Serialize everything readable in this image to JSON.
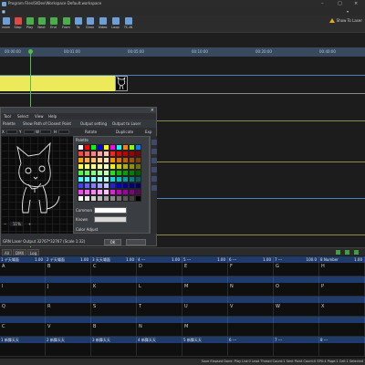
{
  "window": {
    "title": "Program Files\\StDev\\Workspace Default.workspace"
  },
  "toolbar": {
    "buttons": [
      {
        "label": "ream",
        "icon": "stream-icon"
      },
      {
        "label": "Stop",
        "icon": "stop-icon"
      },
      {
        "label": "Play",
        "icon": "play-icon"
      },
      {
        "label": "Next",
        "icon": "next-icon"
      },
      {
        "label": "End",
        "icon": "end-icon"
      },
      {
        "label": "From",
        "icon": "from-icon"
      },
      {
        "label": "To",
        "icon": "to-icon"
      },
      {
        "label": "Clear",
        "icon": "clear-icon"
      },
      {
        "label": "Video",
        "icon": "video-icon"
      },
      {
        "label": "Loop",
        "icon": "loop-icon"
      },
      {
        "label": "TC-IN",
        "icon": "tc-in-icon"
      }
    ],
    "right_label": "Show To Laser"
  },
  "ruler": {
    "ticks": [
      "00:00:00",
      "00:01:00",
      "00:05:00",
      "00:10:00",
      "00:20:00",
      "00:40:00"
    ]
  },
  "dialog": {
    "menu": [
      "Tool",
      "Select",
      "View",
      "Help"
    ],
    "tools": [
      "Palette",
      "Show Path of Closest Point",
      "Output setting",
      "Output to Laser"
    ],
    "fields": [
      "X",
      "Y",
      "W",
      "H",
      "Rotate",
      "Duplicate",
      "Exp"
    ],
    "zoom": "11%",
    "status": "GRN Laser Output 32767*32767 (Scale 1:32)",
    "ok_label": "OK"
  },
  "palette": {
    "header": "Palette",
    "common_label": "Common",
    "known_label": "Known",
    "color_adjust_label": "Color Adjust",
    "colors": [
      "#ffffff",
      "#ff0000",
      "#00ff00",
      "#0000ff",
      "#ffff00",
      "#ff00ff",
      "#00ffff",
      "#ff8000",
      "#80ff00",
      "#0080ff",
      "#ff4040",
      "#ff6060",
      "#ff8080",
      "#ffa0a0",
      "#ffc0c0",
      "#ff2020",
      "#e00000",
      "#c00000",
      "#a00000",
      "#800000",
      "#ffa500",
      "#ffb030",
      "#ffc060",
      "#ffd090",
      "#ffe0b0",
      "#ff9000",
      "#e07000",
      "#c06000",
      "#a05000",
      "#804000",
      "#ffff40",
      "#ffff60",
      "#ffff80",
      "#ffffa0",
      "#ffffc0",
      "#f0f000",
      "#d0d000",
      "#b0b000",
      "#909000",
      "#707000",
      "#40ff40",
      "#60ff60",
      "#80ff80",
      "#a0ffa0",
      "#c0ffc0",
      "#20e020",
      "#00c000",
      "#00a000",
      "#008000",
      "#006000",
      "#40ffff",
      "#60ffff",
      "#80ffff",
      "#a0ffff",
      "#c0ffff",
      "#00e0e0",
      "#00c0c0",
      "#00a0a0",
      "#008080",
      "#006060",
      "#4040ff",
      "#6060ff",
      "#8080ff",
      "#a0a0ff",
      "#c0c0ff",
      "#2020e0",
      "#0000c0",
      "#0000a0",
      "#000080",
      "#000060",
      "#ff40ff",
      "#ff60ff",
      "#ff80ff",
      "#ffa0ff",
      "#ffc0ff",
      "#e020e0",
      "#c000c0",
      "#a000a0",
      "#800080",
      "#600060",
      "#ffffff",
      "#e8e8e8",
      "#d0d0d0",
      "#b8b8b8",
      "#a0a0a0",
      "#888888",
      "#707070",
      "#585858",
      "#404040",
      "#000000"
    ]
  },
  "bottom_tabs": [
    "All",
    "DMX",
    "Log"
  ],
  "cue_grid": {
    "rows": [
      {
        "headers": [
          "1 デ天場面",
          "1.00",
          "2 デ天場面",
          "1.00",
          "3 天天場面",
          "1.00",
          "4 ---",
          "1.00",
          "5 ---",
          "1.00",
          "6 ---",
          "1.00",
          "7 ---",
          "100.0",
          "8 Number",
          "1.00"
        ],
        "bodies": [
          "A",
          "B",
          "C",
          "D",
          "E",
          "F",
          "G",
          "H"
        ]
      },
      {
        "headers": [
          "",
          "",
          "",
          "",
          "",
          "",
          "",
          "",
          "",
          "",
          "",
          "",
          "",
          "",
          "",
          ""
        ],
        "bodies": [
          "I",
          "J",
          "K",
          "L",
          "M",
          "N",
          "O",
          "P"
        ]
      },
      {
        "headers": [
          "",
          "",
          "",
          "",
          "",
          "",
          "",
          "",
          "",
          "",
          "",
          "",
          "",
          "",
          "",
          ""
        ],
        "bodies": [
          "Q",
          "R",
          "S",
          "T",
          "U",
          "V",
          "W",
          "X"
        ]
      },
      {
        "headers": [
          "",
          "",
          "",
          "",
          "",
          "",
          "",
          "",
          "",
          "",
          "",
          "",
          "",
          "",
          "",
          ""
        ],
        "bodies": [
          "C",
          "V",
          "B",
          "N",
          "M",
          "",
          "",
          ""
        ]
      },
      {
        "headers": [
          "1 新舞天天",
          "",
          "2 新舞天天",
          "",
          "3 新舞天天",
          "",
          "4 新舞天天",
          "",
          "5 新舞天天",
          "",
          "6 ---",
          "",
          "7 ---",
          "",
          "8 ---",
          ""
        ],
        "bodies": [
          "",
          "",
          "",
          "",
          "",
          "",
          "",
          ""
        ]
      }
    ]
  },
  "statusbar": {
    "text": "Save Elapsed Done: Play List:0 Lead Thread Count:1 Sent Point Count:0 SPU:4 Page:1 Cell:1 Selected"
  }
}
